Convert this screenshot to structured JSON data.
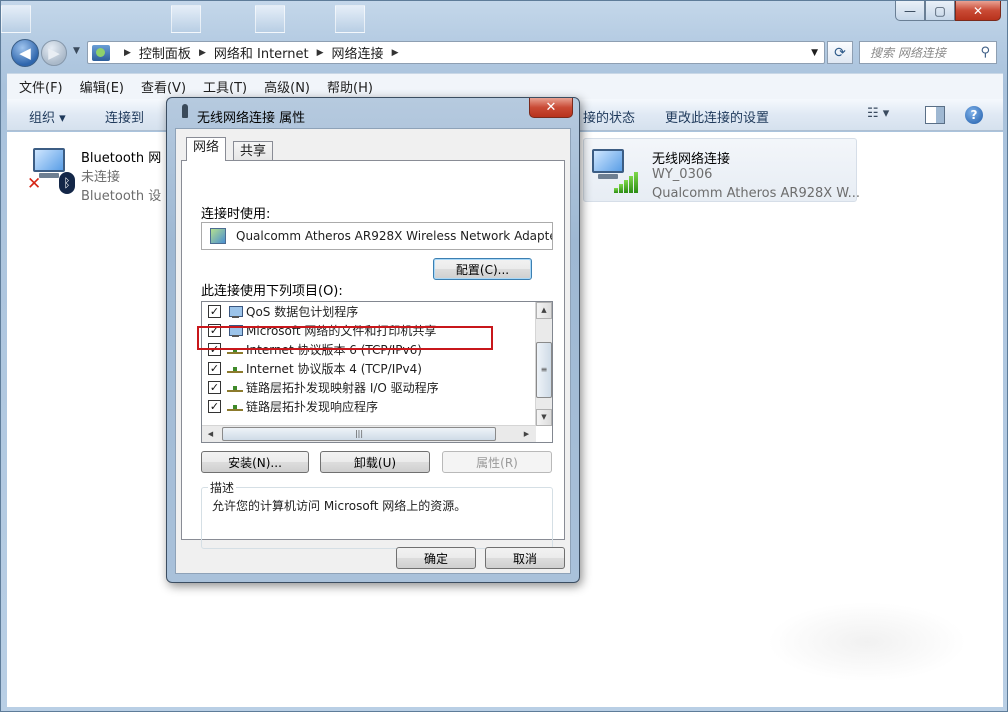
{
  "window": {
    "caption_min": "—",
    "caption_max": "▢",
    "caption_close": "✕"
  },
  "address": {
    "breadcrumb": [
      "控制面板",
      "网络和 Internet",
      "网络连接"
    ],
    "search_placeholder": "搜索 网络连接"
  },
  "menu": [
    "文件(F)",
    "编辑(E)",
    "查看(V)",
    "工具(T)",
    "高级(N)",
    "帮助(H)"
  ],
  "command_bar": {
    "organize": "组织 ▾",
    "connect_to": "连接到",
    "view_status": "接的状态",
    "change_settings": "更改此连接的设置",
    "icons": [
      "view-options-icon",
      "preview-pane-icon",
      "help-icon"
    ]
  },
  "connections": [
    {
      "name": "Bluetooth 网",
      "status": "未连接",
      "device": "Bluetooth 设",
      "icon": "bluetooth-network-icon",
      "state": "disconnected"
    },
    {
      "name": "无线网络连接",
      "status": "WY_0306",
      "device": "Qualcomm Atheros AR928X W...",
      "icon": "wireless-network-icon",
      "state": "connected"
    }
  ],
  "dialog": {
    "title": "无线网络连接 属性",
    "close": "✕",
    "tabs": [
      "网络",
      "共享"
    ],
    "active_tab": "网络",
    "connect_using_label": "连接时使用:",
    "adapter": "Qualcomm Atheros AR928X Wireless Network Adapte",
    "configure_button": "配置(C)...",
    "items_label": "此连接使用下列项目(O):",
    "items": [
      {
        "label": "QoS 数据包计划程序",
        "checked": true,
        "icon": "service"
      },
      {
        "label": "Microsoft 网络的文件和打印机共享",
        "checked": true,
        "icon": "service"
      },
      {
        "label": "Internet 协议版本 6 (TCP/IPv6)",
        "checked": true,
        "icon": "protocol"
      },
      {
        "label": "Internet 协议版本 4 (TCP/IPv4)",
        "checked": true,
        "icon": "protocol",
        "highlighted": true
      },
      {
        "label": "链路层拓扑发现映射器 I/O 驱动程序",
        "checked": true,
        "icon": "protocol"
      },
      {
        "label": "链路层拓扑发现响应程序",
        "checked": true,
        "icon": "protocol"
      }
    ],
    "install_button": "安装(N)...",
    "uninstall_button": "卸载(U)",
    "properties_button": "属性(R)",
    "description_legend": "描述",
    "description_text": "允许您的计算机访问 Microsoft 网络上的资源。",
    "ok_button": "确定",
    "cancel_button": "取消",
    "highlight_color": "#c8171b"
  }
}
